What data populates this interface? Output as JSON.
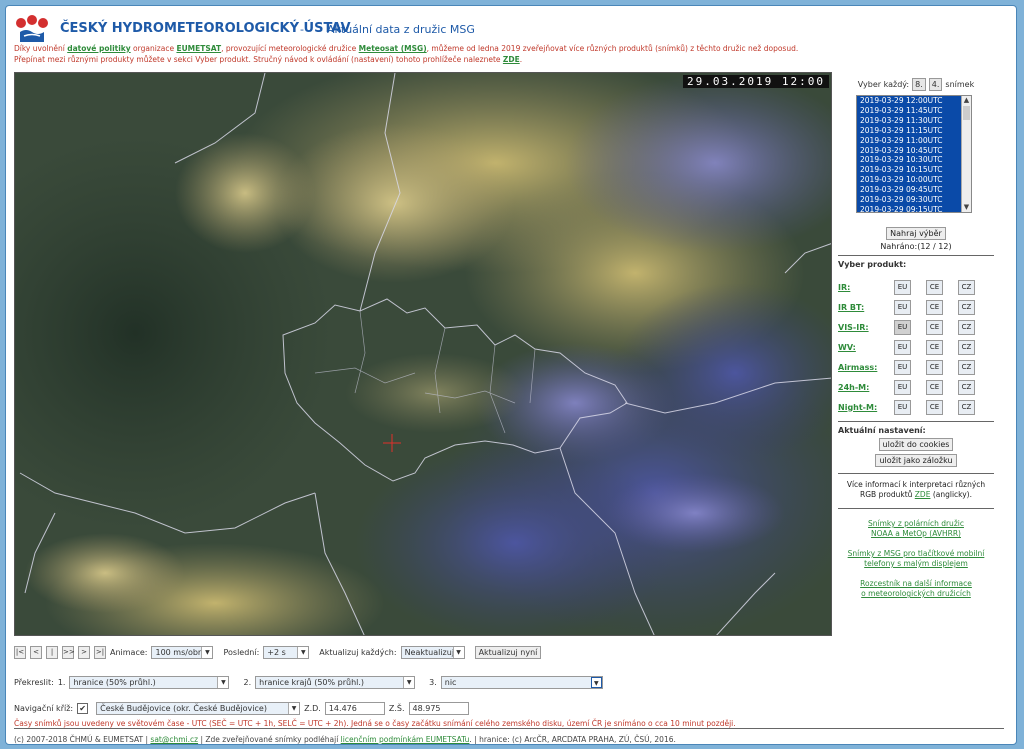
{
  "header": {
    "site_title": "ČESKÝ HYDROMETEOROLOGICKÝ ÚSTAV",
    "dash": "-",
    "subtitle": "Aktuální data z družic MSG"
  },
  "notice": {
    "line1_a": "Díky uvolnění ",
    "link_policy": "datové politiky",
    "line1_b": " organizace ",
    "link_eumetsat": "EUMETSAT",
    "line1_c": ", provozující meteorologické družice ",
    "link_meteosat": "Meteosat (MSG)",
    "line1_d": ", můžeme od ledna 2019 zveřejňovat více různých produktů (snímků) z těchto družic než doposud.",
    "line2_a": "Přepínat mezi různými produkty můžete v sekci Vyber produkt. Stručný návod k ovládání (nastavení) tohoto prohlížeče naleznete ",
    "link_zde": "ZDE",
    "line2_b": "."
  },
  "map": {
    "timestamp": "29.03.2019 12:00"
  },
  "sidebar": {
    "every_label": "Vyber každý:",
    "every_btn1": "8.",
    "every_btn2": "4.",
    "every_suffix": "snímek",
    "frames": [
      "2019-03-29 12:00UTC",
      "2019-03-29 11:45UTC",
      "2019-03-29 11:30UTC",
      "2019-03-29 11:15UTC",
      "2019-03-29 11:00UTC",
      "2019-03-29 10:45UTC",
      "2019-03-29 10:30UTC",
      "2019-03-29 10:15UTC",
      "2019-03-29 10:00UTC",
      "2019-03-29 09:45UTC",
      "2019-03-29 09:30UTC",
      "2019-03-29 09:15UTC"
    ],
    "load_btn": "Nahraj výběr",
    "loaded": "Nahráno:(12 / 12)",
    "product_heading": "Vyber produkt:",
    "products": [
      {
        "name": "IR:",
        "b1": "EU",
        "b2": "CE",
        "b3": "CZ"
      },
      {
        "name": "IR BT:",
        "b1": "EU",
        "b2": "CE",
        "b3": "CZ"
      },
      {
        "name": "VIS-IR:",
        "b1": "EU",
        "b2": "CE",
        "b3": "CZ"
      },
      {
        "name": "WV:",
        "b1": "EU",
        "b2": "CE",
        "b3": "CZ"
      },
      {
        "name": "Airmass:",
        "b1": "EU",
        "b2": "CE",
        "b3": "CZ"
      },
      {
        "name": "24h-M:",
        "b1": "EU",
        "b2": "CE",
        "b3": "CZ"
      },
      {
        "name": "Night-M:",
        "b1": "EU",
        "b2": "CE",
        "b3": "CZ"
      }
    ],
    "settings_heading": "Aktuální nastavení:",
    "save_cookies": "uložit do cookies",
    "save_bookmark": "uložit jako záložku",
    "rgb_info_a": "Více informací k interpretaci různých",
    "rgb_info_b": "RGB produktů ",
    "rgb_info_link": "ZDE",
    "rgb_info_c": " (anglicky).",
    "link1_a": "Snímky z polárních družic",
    "link1_b": "NOAA a MetOp (AVHRR)",
    "link2_a": "Snímky z MSG pro tlačítkové mobilní",
    "link2_b": "telefony s malým displejem",
    "link3_a": "Rozcestník na další informace",
    "link3_b": "o meteorologických družicích"
  },
  "controls": {
    "nav_first": "|<",
    "nav_prev": "<",
    "nav_stop": "|",
    "nav_play": ">>",
    "nav_next": ">",
    "nav_last": ">|",
    "animation_label": "Animace:",
    "animation_value": "100 ms/obr",
    "last_label": "Poslední:",
    "last_value": "+2 s",
    "update_label": "Aktualizuj každých:",
    "update_value": "Neaktualizuj",
    "update_now": "Aktualizuj nyní",
    "overlay_label": "Překreslit:",
    "ov1_num": "1.",
    "ov1_value": "hranice (50% průhl.)",
    "ov2_num": "2.",
    "ov2_value": "hranice krajů (50% průhl.)",
    "ov3_num": "3.",
    "ov3_value": "nic",
    "crosshair_label": "Navigační kříž:",
    "checkmark": "✔",
    "location_value": "České Budějovice (okr. České Budějovice)",
    "lon_label": "Z.D.",
    "lon_value": "14.476",
    "lat_label": "Z.Š.",
    "lat_value": "48.975",
    "time_note": "Časy snímků jsou uvedeny ve světovém čase - UTC (SEČ = UTC + 1h, SELČ = UTC + 2h). Jedná se o časy začátku snímání celého zemského disku, území ČR je snímáno o cca 10 minut později."
  },
  "footer": {
    "text_a": "(c) 2007-2018 ČHMÚ & EUMETSAT | ",
    "email": "sat@chmi.cz",
    "text_b": " | Zde zveřejňované snímky podléhají ",
    "license": "licenčním podmínkám EUMETSATu",
    "text_c": ". | hranice: (c) ArcČR, ARCDATA PRAHA, ZÚ, ČSÚ, 2016."
  },
  "colors": {
    "title_blue": "#1e5aa8",
    "notice_red": "#c0392b",
    "link_green": "#2e8b3a",
    "frame_list_bg": "#0a4aa8"
  }
}
